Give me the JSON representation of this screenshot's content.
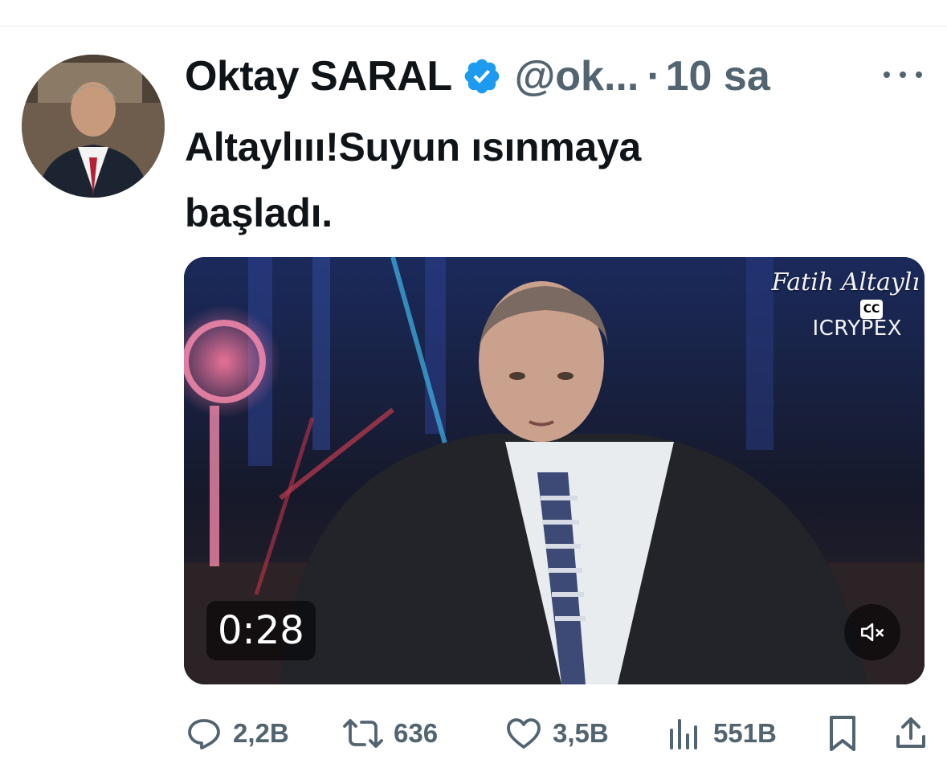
{
  "author": {
    "name": "Oktay SARAL",
    "handle": "@ok...",
    "separator": "·",
    "time": "10 sa",
    "verified": true
  },
  "tweet": {
    "text": "Altaylııı!Suyun ısınmaya\nbaşladı."
  },
  "media": {
    "watermark_name": "Fatih Altaylı",
    "watermark_brand": "ICRYPEX",
    "cc_label": "CC",
    "duration": "0:28",
    "muted": true
  },
  "actions": {
    "replies": "2,2B",
    "retweets": "636",
    "likes": "3,5B",
    "views": "551B"
  },
  "icons": {
    "verified": "verified-badge-icon",
    "more": "more-icon",
    "reply": "reply-icon",
    "retweet": "retweet-icon",
    "like": "heart-icon",
    "views": "views-chart-icon",
    "bookmark": "bookmark-icon",
    "share": "share-icon",
    "mute": "speaker-muted-icon"
  },
  "colors": {
    "text": "#0f1419",
    "secondary": "#536471",
    "verified": "#1d9bf0"
  }
}
